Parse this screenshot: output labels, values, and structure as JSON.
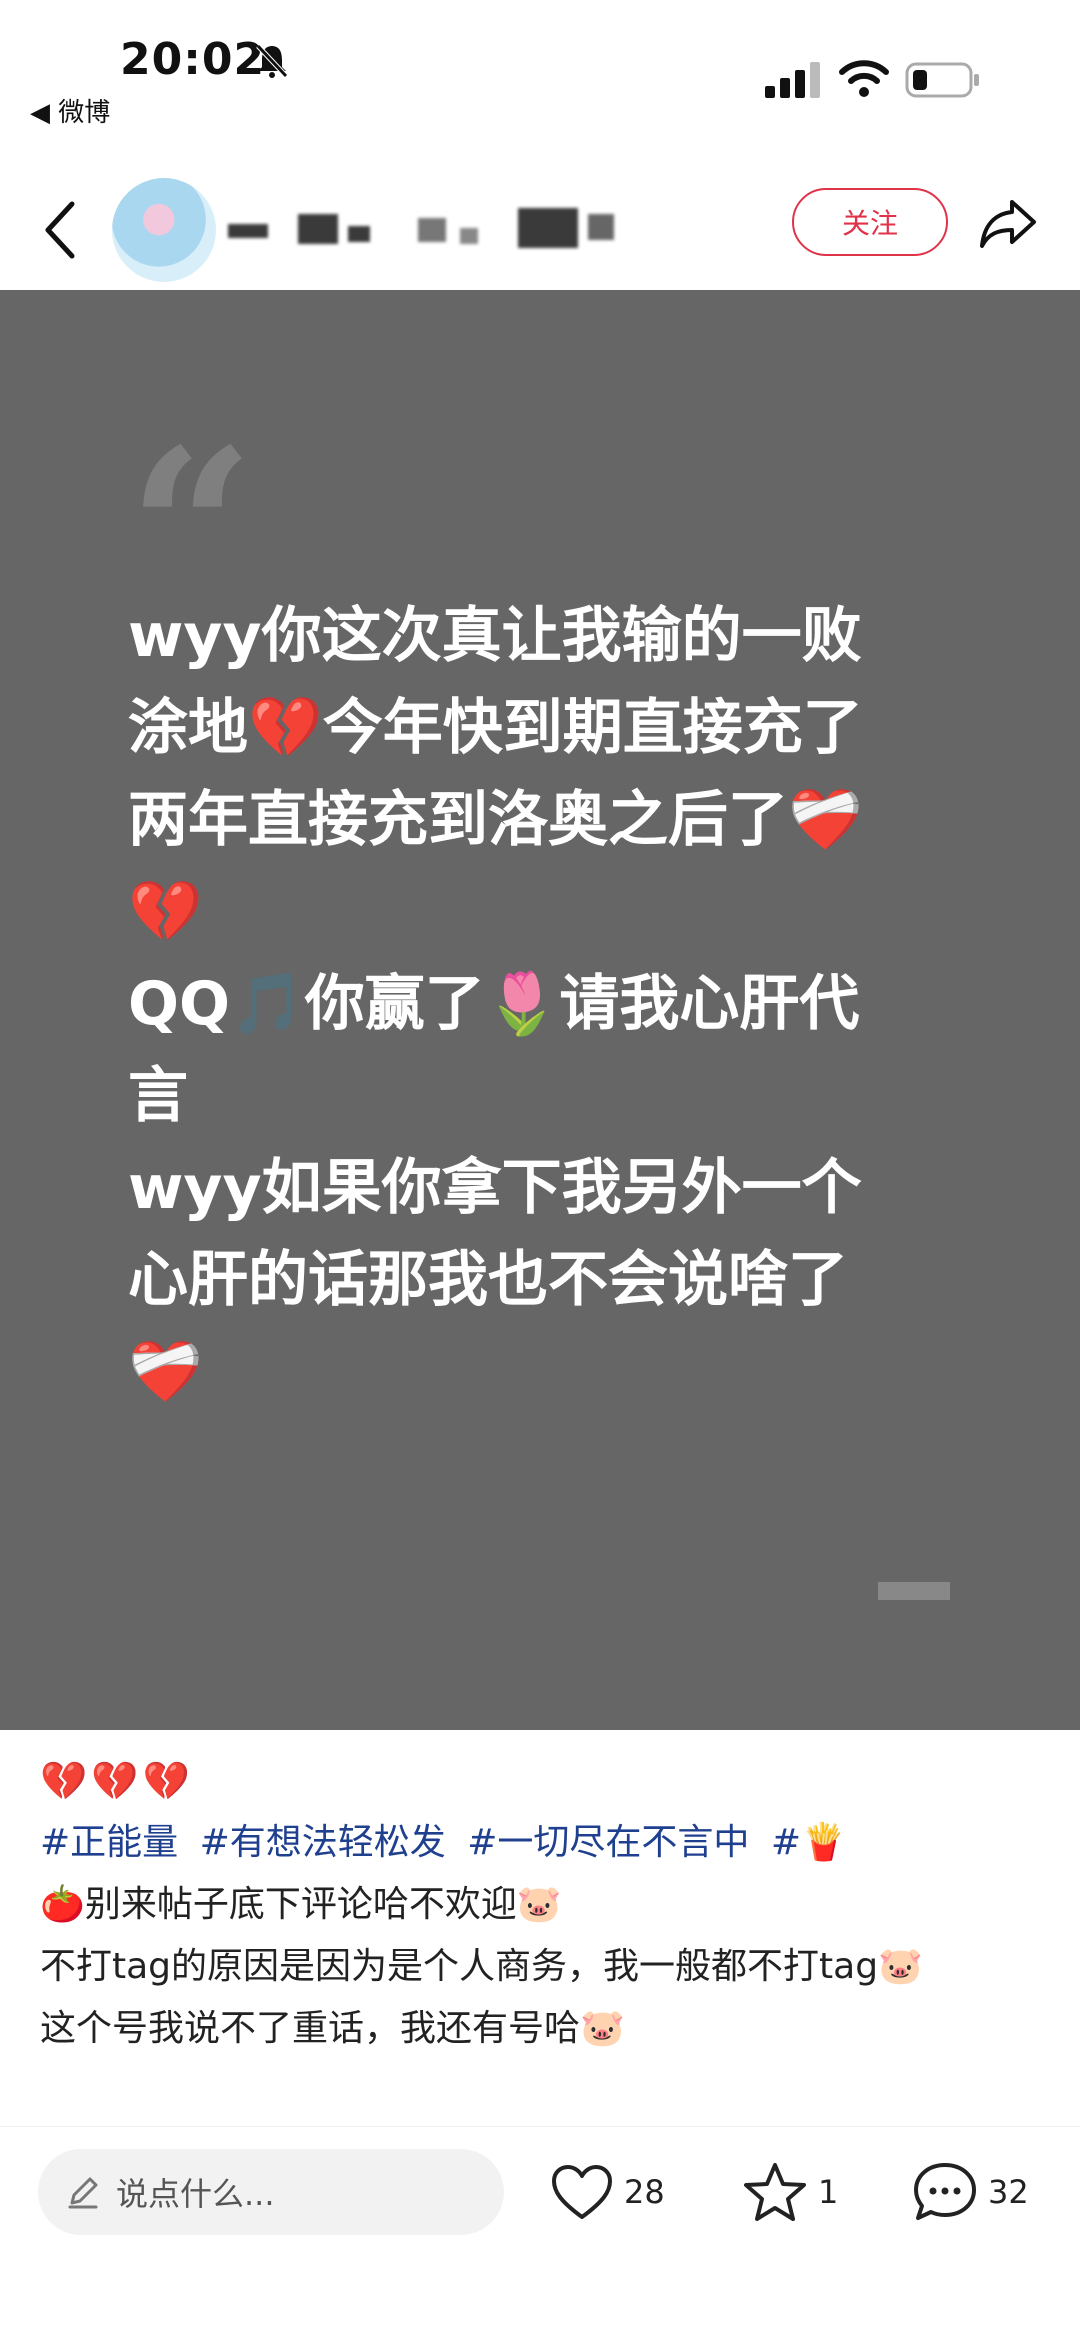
{
  "status_bar": {
    "time": "20:02",
    "back_app": "◀ 微博",
    "icons": [
      "bell-off-icon",
      "signal-icon",
      "wifi-icon",
      "battery-icon"
    ]
  },
  "header": {
    "follow_label": "关注",
    "icons": [
      "back-icon",
      "share-icon"
    ]
  },
  "card": {
    "quote_mark": "“",
    "text": "wyy你这次真让我输的一败\n涂地💔今年快到期直接充了\n两年直接充到洛奥之后了❤️‍🩹\n💔\nQQ🎵你赢了🌷请我心肝代\n言\nwyy如果你拿下我另外一个\n心肝的话那我也不会说啥了\n❤️‍🩹"
  },
  "post": {
    "emoji_row": "💔💔💔",
    "hashtags": [
      "#正能量",
      "#有想法轻松发",
      "#一切尽在不言中",
      "#🍟"
    ],
    "lines": [
      "🍅别来帖子底下评论哈不欢迎🐷",
      "不打tag的原因是因为是个人商务，我一般都不打tag🐷",
      "这个号我说不了重话，我还有号哈🐷"
    ]
  },
  "bottom_bar": {
    "input_placeholder": "说点什么...",
    "likes": "28",
    "stars": "1",
    "comments": "32",
    "icons": [
      "pencil-icon",
      "heart-icon",
      "star-icon",
      "comment-icon"
    ]
  },
  "colors": {
    "accent": "#e0334a",
    "card_bg": "#666666",
    "hashtag": "#1f3f8f"
  }
}
